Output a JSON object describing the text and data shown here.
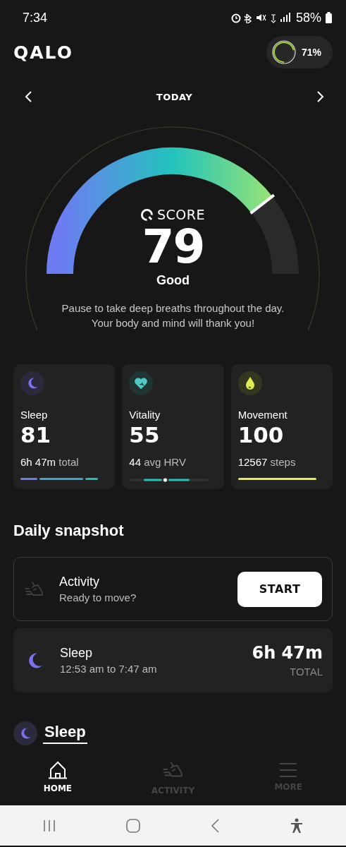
{
  "status_bar": {
    "time": "7:34",
    "battery": "58%"
  },
  "header": {
    "logo": "QALO",
    "device": {
      "reading": "71%"
    }
  },
  "date_nav": {
    "label": "TODAY"
  },
  "score": {
    "label": "SCORE",
    "value": "79",
    "rating": "Good",
    "message": "Pause to take deep breaths throughout the day. Your body and mind will thank you!"
  },
  "metrics": [
    {
      "kind": "sleep",
      "title": "Sleep",
      "value": "81",
      "detail": "6h 47m",
      "unit": "total"
    },
    {
      "kind": "vitality",
      "title": "Vitality",
      "value": "55",
      "detail": "44",
      "unit": "avg HRV"
    },
    {
      "kind": "movement",
      "title": "Movement",
      "value": "100",
      "detail": "12567",
      "unit": "steps"
    }
  ],
  "snapshot": {
    "title": "Daily snapshot",
    "items": [
      {
        "kind": "activity",
        "title": "Activity",
        "subtitle": "Ready to move?",
        "action": "START"
      },
      {
        "kind": "sleep",
        "title": "Sleep",
        "subtitle": "12:53 am to 7:47 am",
        "value": "6h 47m",
        "caption": "TOTAL"
      }
    ]
  },
  "section": {
    "title": "Sleep"
  },
  "bottom_nav": [
    {
      "label": "HOME",
      "kind": "home",
      "selected": true
    },
    {
      "label": "ACTIVITY",
      "kind": "activity",
      "selected": false
    },
    {
      "label": "MORE",
      "kind": "more",
      "selected": false
    }
  ]
}
